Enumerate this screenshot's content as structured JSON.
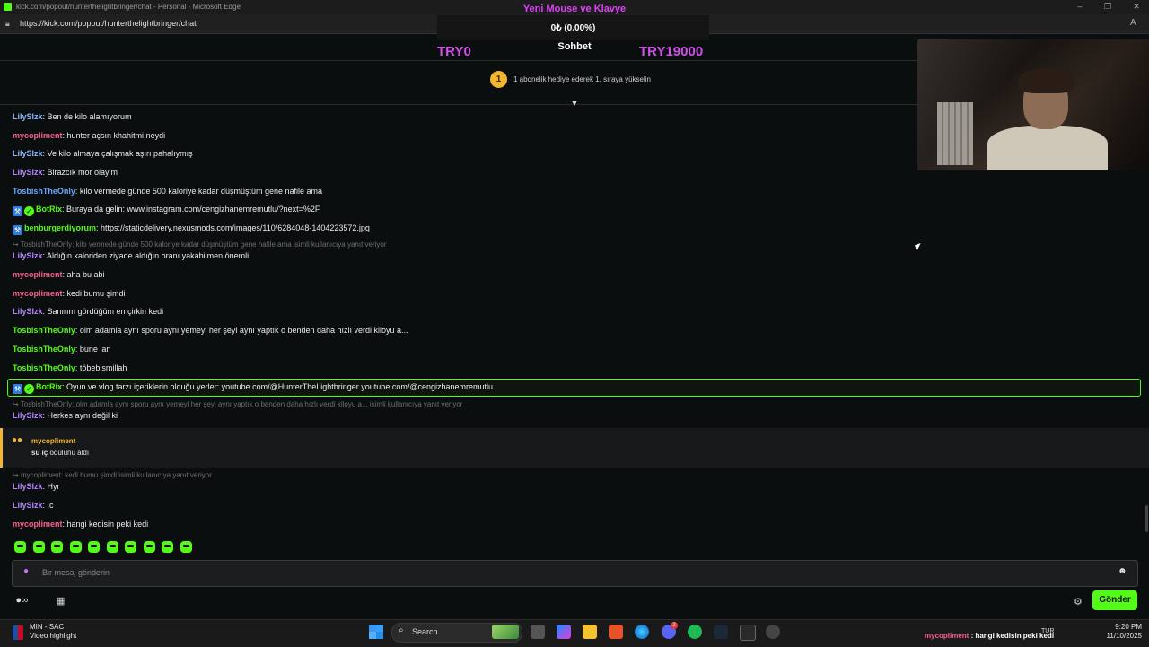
{
  "window": {
    "title": "kick.com/popout/hunterthelightbringer/chat - Personal - Microsoft Edge",
    "url": "https://kick.com/popout/hunterthelightbringer/chat"
  },
  "goal": {
    "title": "Yeni Mouse ve Klavye",
    "progress": "0₺ (0.00%)",
    "min": "TRY0",
    "max": "TRY19000"
  },
  "chat_header": "Sohbet",
  "gift_banner": {
    "rank": "1",
    "text": "1 abonelik hediye ederek 1. sıraya yükselin"
  },
  "messages": [
    {
      "user": "LilySlzk",
      "text": ": Ben de kilo alamıyorum"
    },
    {
      "user": "mycopliment",
      "text": ": hunter açsın khahitmi neydi"
    },
    {
      "user": "LilySlzk",
      "text": ": Ve kilo almaya çalışmak aşırı pahalıymış"
    },
    {
      "user": "LilySlzk",
      "text": ": Birazcık mor olayim"
    },
    {
      "user": "TosbishTheOnly",
      "text": ": kilo vermede günde 500 kaloriye kadar düşmüştüm gene nafile ama"
    },
    {
      "user": "BotRix",
      "text": ": Buraya da gelin: www.instagram.com/cengizhanemremutlu/?next=%2F"
    },
    {
      "user": "benburgerdiyorum",
      "text": ": ",
      "link": "https://staticdelivery.nexusmods.com/images/110/6284048-1404223572.jpg"
    },
    {
      "reply": "TosbishTheOnly: kilo vermede günde 500 kaloriye kadar düşmüştüm gene nafile ama isimli kullanıcıya yanıt veriyor"
    },
    {
      "user": "LilySlzk",
      "text": ": Aldığın kaloriden ziyade aldığın oranı yakabilmen önemli"
    },
    {
      "user": "mycopliment",
      "text": ": aha bu abi"
    },
    {
      "user": "mycopliment",
      "text": ": kedi bumu şimdi"
    },
    {
      "user": "LilySlzk",
      "text": ": Sanırım gördüğüm en çirkin kedi"
    },
    {
      "user": "TosbishTheOnly",
      "text": ": olm adamla aynı sporu aynı yemeyi her şeyi aynı yaptık o benden daha hızlı verdi kiloyu a..."
    },
    {
      "user": "TosbishTheOnly",
      "text": ": bune lan"
    },
    {
      "user": "TosbishTheOnly",
      "text": ": töbebismillah"
    },
    {
      "user": "BotRix",
      "text": ": Oyun ve vlog tarzı içeriklerin olduğu yerler: youtube.com/@HunterTheLightbringer youtube.com/@cengizhanemremutlu"
    },
    {
      "reply": "TosbishTheOnly: olm adamla aynı sporu aynı yemeyi her şeyi aynı yaptık o benden daha hızlı verdi kiloyu a... isimli kullanıcıya yanıt veriyor"
    },
    {
      "user": "LilySlzk",
      "text": ": Herkes aynı değil ki"
    },
    {
      "reply": "mycopliment: kedi bumu şimdi isimli kullanıcıya yanıt veriyor"
    },
    {
      "user": "LilySlzk",
      "text": ": Hyr"
    },
    {
      "user": "LilySlzk",
      "text": ": :c"
    },
    {
      "user": "mycopliment",
      "text": ": hangi kedisin peki kedi"
    }
  ],
  "reward": {
    "user": "mycopliment",
    "reward_name": "su iç",
    "suffix": " ödülünü aldı"
  },
  "input": {
    "placeholder": "Bir mesaj gönderin"
  },
  "send_label": "Gönder",
  "taskbar": {
    "score_line1": "MIN - SAC",
    "score_line2": "Video highlight",
    "search_label": "Search",
    "lang": "TUR",
    "time": "9:20 PM",
    "date": "11/10/2025",
    "discord_badge": "2"
  },
  "caption": {
    "user": "mycopliment",
    "text": " : hangi kedisin peki kedi"
  },
  "colors": {
    "accent": "#53fc18",
    "goal": "#d050e8",
    "reward": "#f2b632"
  }
}
